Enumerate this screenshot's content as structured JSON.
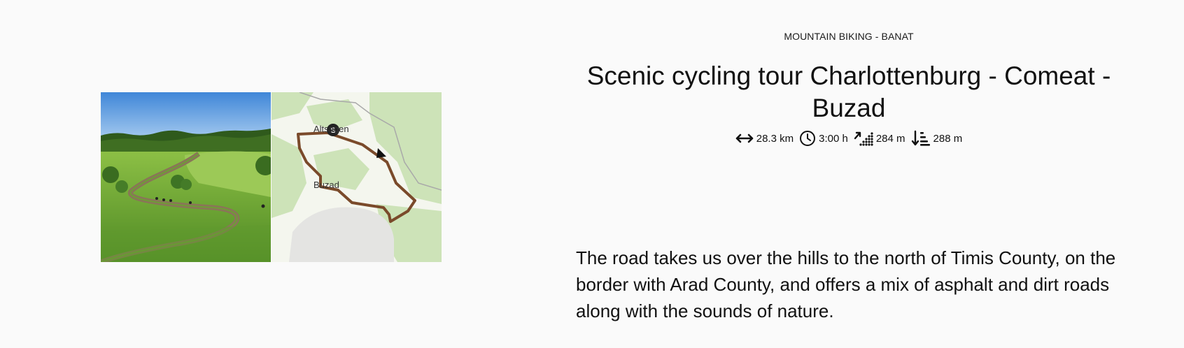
{
  "tour": {
    "category": "MOUNTAIN BIKING - BANAT",
    "title": "Scenic cycling tour Charlottenburg - Comeat - Buzad",
    "description": "The road takes us over the hills to the north of Timis County, on the border with Arad County, and offers a mix of asphalt and dirt roads along with the sounds of nature."
  },
  "stats": {
    "distance": "28.3 km",
    "duration": "3:00 h",
    "ascent": "284 m",
    "descent": "288 m"
  },
  "map": {
    "label_start_town": "Altsagen",
    "label_end_town": "Buzad",
    "start_marker": "S"
  },
  "icons": {
    "distance": "horizontal-arrows-icon",
    "duration": "clock-icon",
    "ascent": "ascent-icon",
    "descent": "descent-icon"
  },
  "colors": {
    "background": "#fafafa",
    "route": "#7a4a2a",
    "map_forest": "#cde3b8",
    "map_land": "#f4f6ee",
    "sky": "#5b9be0",
    "meadow": "#6fa63a"
  }
}
